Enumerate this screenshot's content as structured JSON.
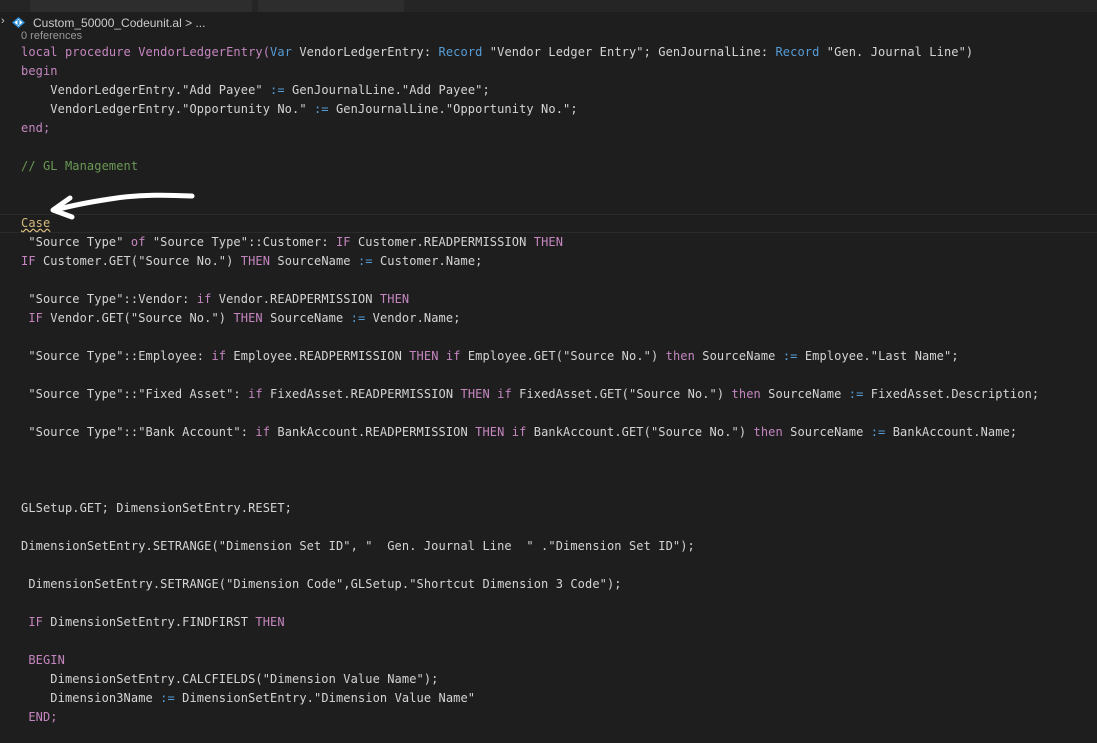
{
  "breadcrumb": {
    "file": "Custom_50000_Codeunit.al",
    "more": " > ..."
  },
  "codelens": "0 references",
  "code": {
    "l1": [
      "local procedure VendorLedgerEntry(",
      "Var",
      " VendorLedgerEntry: ",
      "Record",
      " \"Vendor Ledger Entry\"; GenJournalLine: ",
      "Record",
      " \"Gen. Journal Line\")"
    ],
    "l2": "begin",
    "l3": [
      "    VendorLedgerEntry.\"Add Payee\" ",
      ":=",
      " GenJournalLine.\"Add Payee\";"
    ],
    "l4": [
      "    VendorLedgerEntry.\"Opportunity No.\" ",
      ":=",
      " GenJournalLine.\"Opportunity No.\";"
    ],
    "l5": "end;",
    "l6": "// GL Management",
    "l7": "Case",
    "l8": [
      " \"Source Type\" ",
      "of",
      " \"Source Type\"::Customer: ",
      "IF",
      " Customer.READPERMISSION ",
      "THEN"
    ],
    "l9": [
      "IF",
      " Customer.GET(\"Source No.\") ",
      "THEN",
      " SourceName ",
      ":=",
      " Customer.Name;"
    ],
    "l10": [
      " \"Source Type\"::Vendor: ",
      "if",
      " Vendor.READPERMISSION ",
      "THEN"
    ],
    "l11": [
      " IF",
      " Vendor.GET(\"Source No.\") ",
      "THEN",
      " SourceName ",
      ":=",
      " Vendor.Name;"
    ],
    "l12": [
      " \"Source Type\"::Employee: ",
      "if",
      " Employee.READPERMISSION ",
      "THEN",
      " ",
      "if",
      " Employee.GET(\"Source No.\") ",
      "then",
      " SourceName ",
      ":=",
      " Employee.\"Last Name\";"
    ],
    "l13": [
      " \"Source Type\"::\"Fixed Asset\": ",
      "if",
      " FixedAsset.READPERMISSION ",
      "THEN",
      " ",
      "if",
      " FixedAsset.GET(\"Source No.\") ",
      "then",
      " SourceName ",
      ":=",
      " FixedAsset.Description;"
    ],
    "l14": [
      " \"Source Type\"::\"Bank Account\": ",
      "if",
      " BankAccount.READPERMISSION ",
      "THEN",
      " ",
      "if",
      " BankAccount.GET(\"Source No.\") ",
      "then",
      " SourceName ",
      ":=",
      " BankAccount.Name;"
    ],
    "l15": "GLSetup.GET; DimensionSetEntry.RESET;",
    "l16": "DimensionSetEntry.SETRANGE(\"Dimension Set ID\", \"  Gen. Journal Line  \" .\"Dimension Set ID\");",
    "l17": " DimensionSetEntry.SETRANGE(\"Dimension Code\",GLSetup.\"Shortcut Dimension 3 Code\");",
    "l18": [
      " IF",
      " DimensionSetEntry.FINDFIRST ",
      "THEN"
    ],
    "l19": " BEGIN",
    "l20": "    DimensionSetEntry.CALCFIELDS(\"Dimension Value Name\");",
    "l21": [
      "    Dimension3Name ",
      ":=",
      " DimensionSetEntry.\"Dimension Value Name\""
    ],
    "l22": " END;"
  }
}
